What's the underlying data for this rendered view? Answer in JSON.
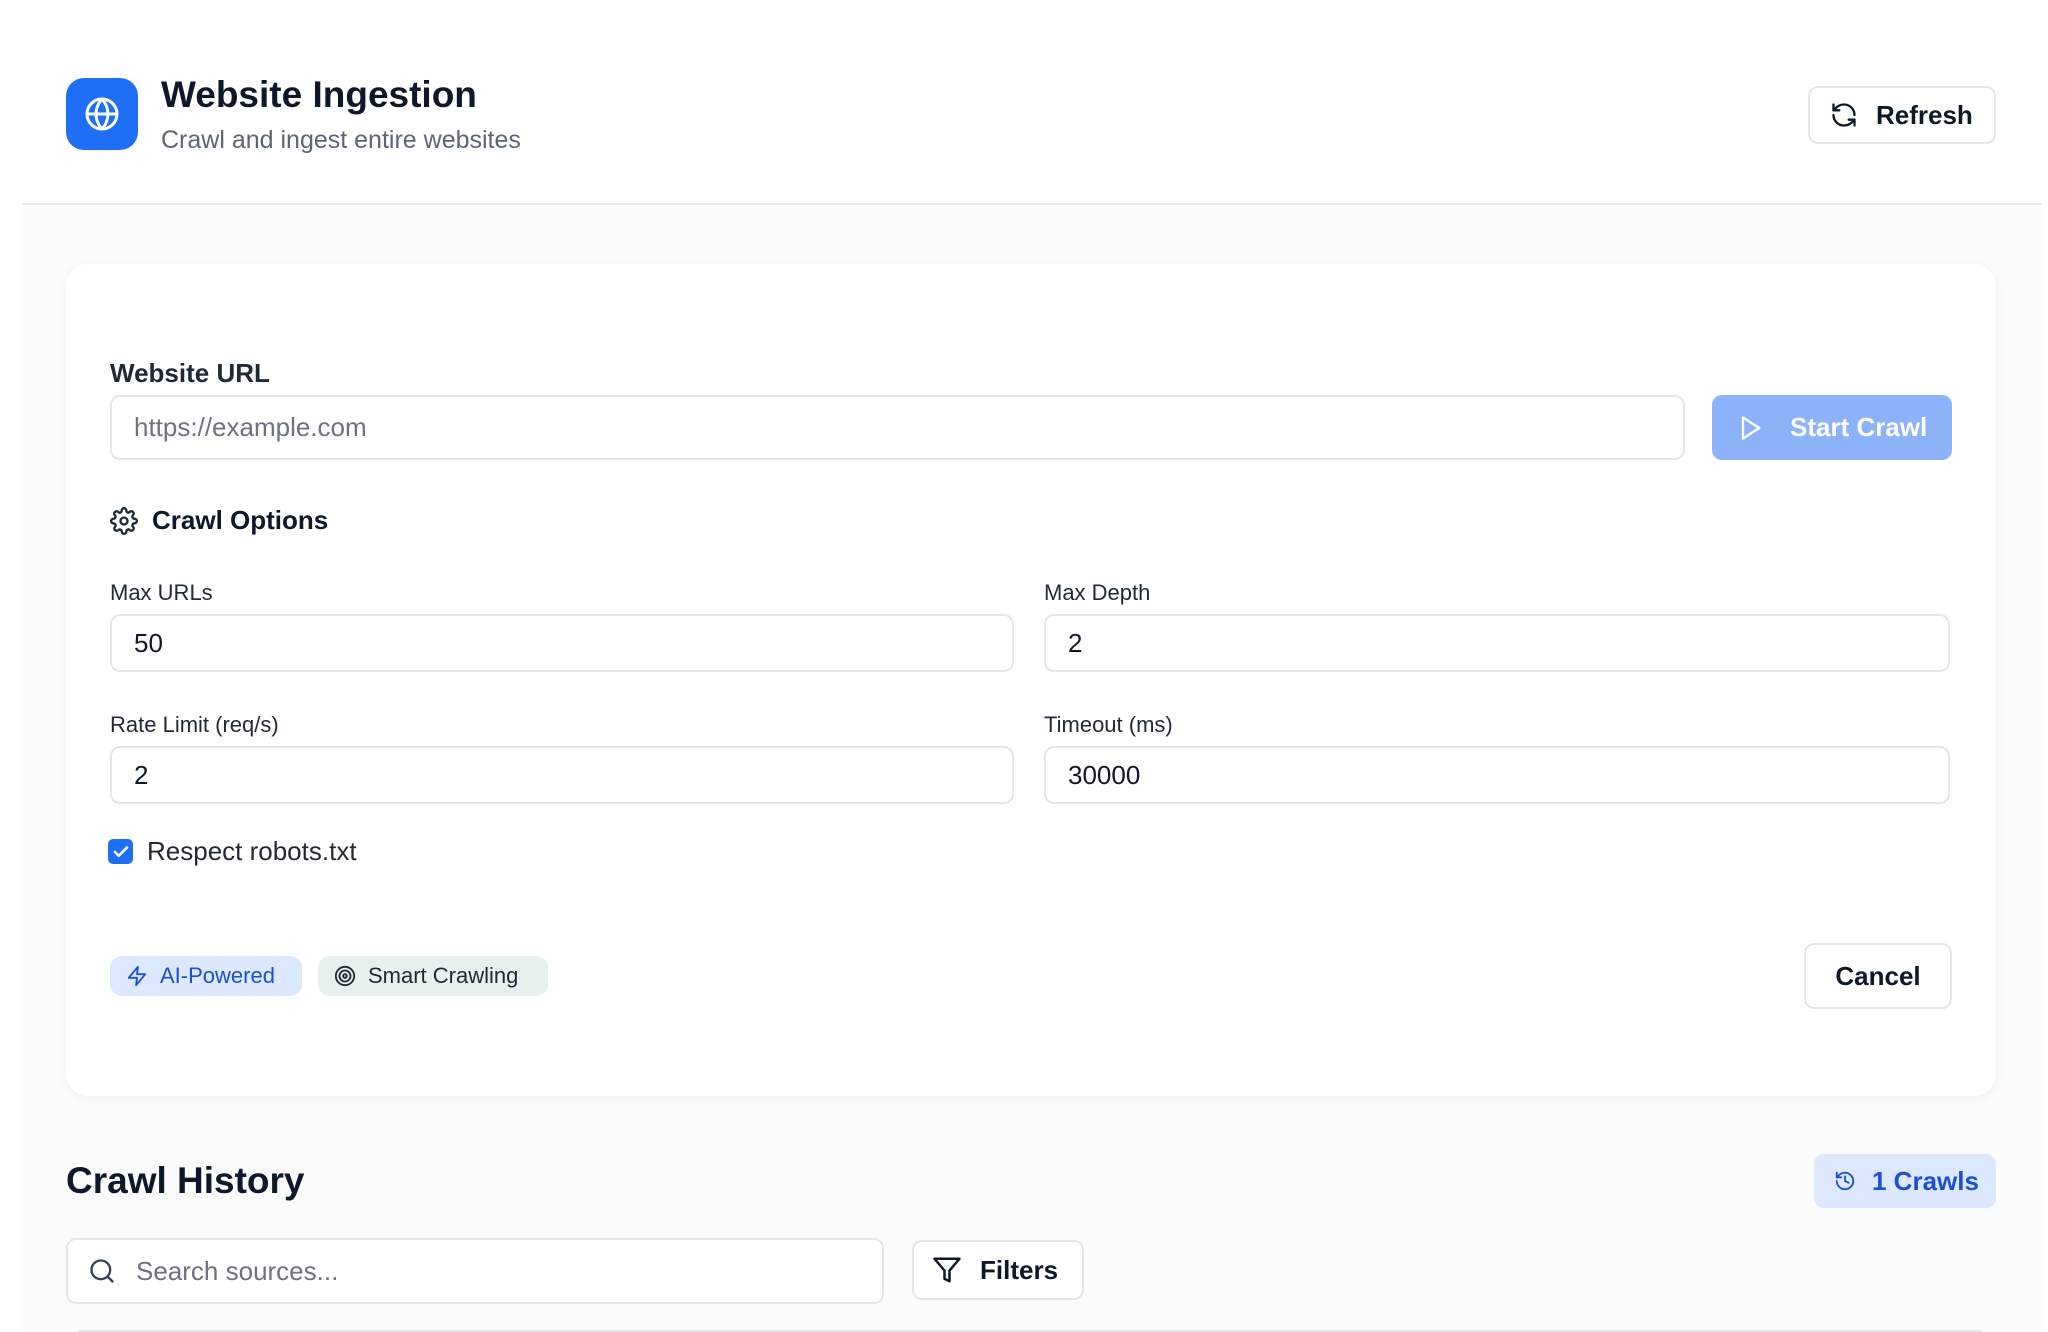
{
  "header": {
    "title": "Website Ingestion",
    "subtitle": "Crawl and ingest entire websites",
    "app_icon": "globe-icon",
    "refresh_label": "Refresh",
    "refresh_icon": "refresh-icon"
  },
  "form": {
    "url_label": "Website URL",
    "url_placeholder": "https://example.com",
    "url_value": "",
    "start_label": "Start Crawl",
    "start_icon": "play-icon",
    "options_title": "Crawl Options",
    "options_icon": "gear-icon",
    "max_urls": {
      "label": "Max URLs",
      "value": "50"
    },
    "max_depth": {
      "label": "Max Depth",
      "value": "2"
    },
    "rate_limit": {
      "label": "Rate Limit (req/s)",
      "value": "2"
    },
    "timeout": {
      "label": "Timeout (ms)",
      "value": "30000"
    },
    "respect_robots": {
      "label": "Respect robots.txt",
      "checked": true
    },
    "badges": [
      {
        "label": "AI-Powered",
        "icon": "lightning-icon"
      },
      {
        "label": "Smart Crawling",
        "icon": "target-icon"
      }
    ],
    "cancel_label": "Cancel"
  },
  "history": {
    "title": "Crawl History",
    "count_label": "1 Crawls",
    "count_icon": "history-icon",
    "search_placeholder": "Search sources...",
    "filters_label": "Filters",
    "filters_icon": "filter-icon"
  },
  "colors": {
    "accent": "#1e6ff5",
    "accent_disabled": "#8cb3fa",
    "badge_blue_bg": "#dbe8fd",
    "badge_green_bg": "#e8f0ee"
  }
}
